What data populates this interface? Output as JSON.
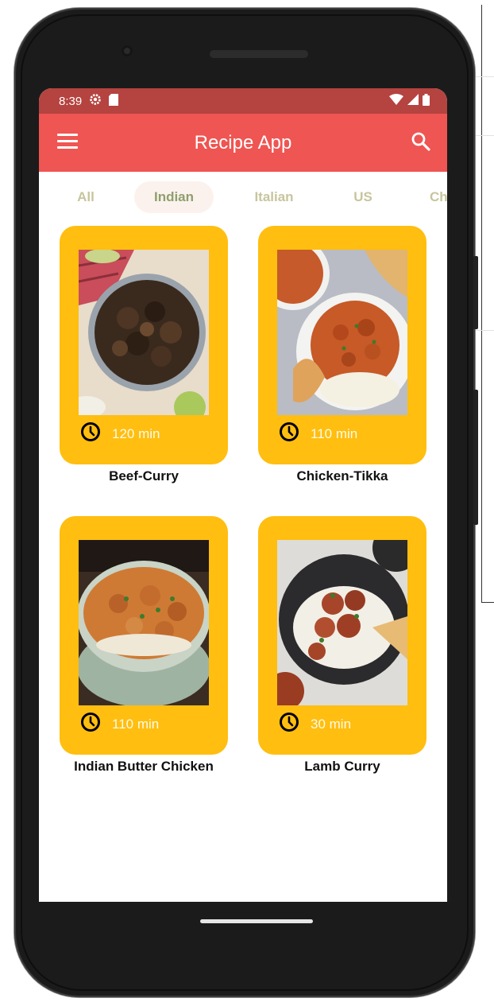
{
  "status_bar": {
    "time": "8:39"
  },
  "app_bar": {
    "title": "Recipe App"
  },
  "tabs": [
    {
      "label": "All"
    },
    {
      "label": "Indian"
    },
    {
      "label": "Italian"
    },
    {
      "label": "US"
    },
    {
      "label": "Ch"
    }
  ],
  "active_tab": "Indian",
  "recipes": [
    {
      "name": "Beef-Curry",
      "time": "120 min"
    },
    {
      "name": "Chicken-Tikka",
      "time": "110 min"
    },
    {
      "name": "Indian Butter Chicken",
      "time": "110 min"
    },
    {
      "name": "Lamb Curry",
      "time": "30 min"
    }
  ],
  "colors": {
    "status_bar": "#b5433f",
    "app_bar": "#ef5552",
    "card": "#ffbe10",
    "tab_inactive": "#c7c59d",
    "tab_active": "#8ea06c",
    "tab_active_bg": "#fbf2ee"
  },
  "icons": {
    "menu": "menu-icon",
    "search": "search-icon",
    "clock": "clock-icon",
    "wifi": "wifi-icon",
    "signal": "signal-icon",
    "battery": "battery-icon",
    "settings": "gear-icon",
    "sim": "sim-card-icon"
  }
}
